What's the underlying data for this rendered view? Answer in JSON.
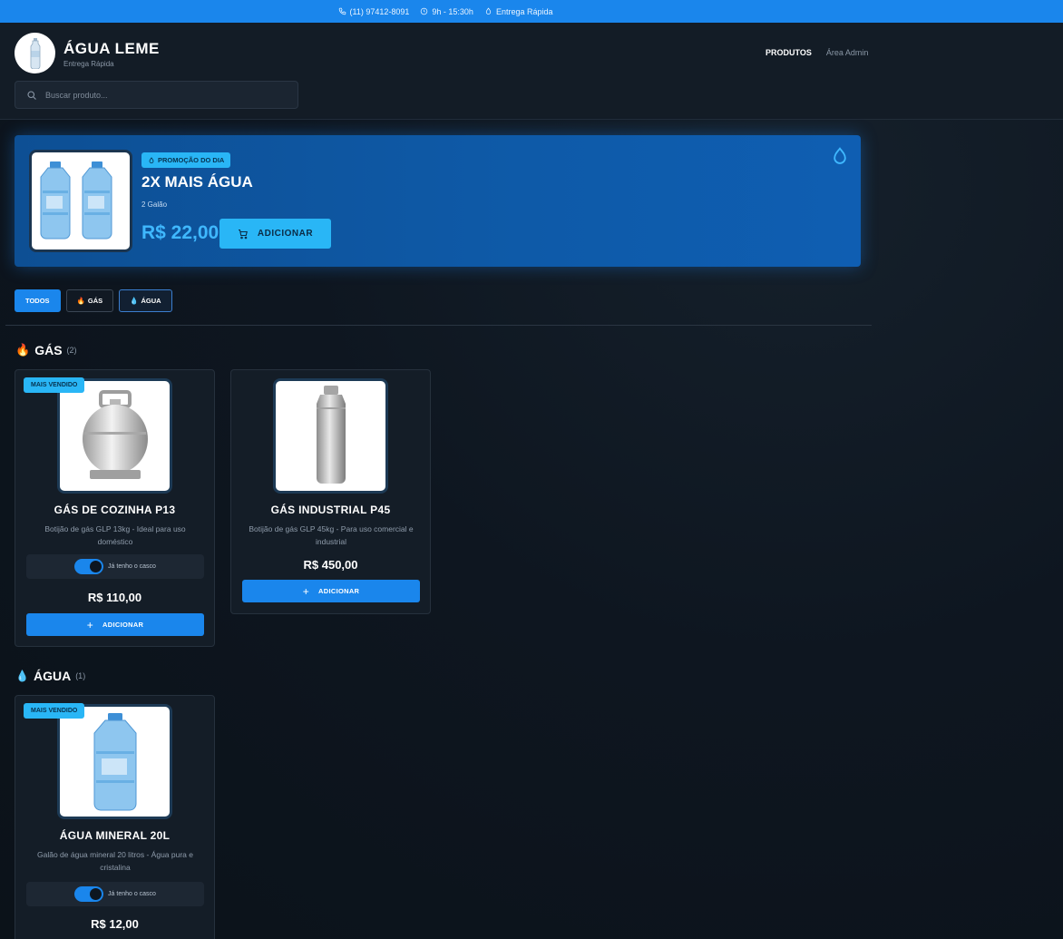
{
  "topbar": {
    "phone": "(11) 97412-8091",
    "hours": "9h - 15:30h",
    "delivery": "Entrega Rápida"
  },
  "header": {
    "brand_name": "ÁGUA LEME",
    "brand_tagline": "Entrega Rápida",
    "nav": [
      {
        "label": "PRODUTOS",
        "active": true
      },
      {
        "label": "Área Admin",
        "active": false
      }
    ],
    "search_placeholder": "Buscar produto..."
  },
  "promo": {
    "badge": "PROMOÇÃO DO DIA",
    "title": "2X MAIS ÁGUA",
    "subtitle": "2 Galão",
    "price": "R$ 22,00",
    "button_label": "ADICIONAR"
  },
  "filters": [
    {
      "label": "TODOS",
      "icon": "",
      "state": "active"
    },
    {
      "label": "GÁS",
      "icon": "🔥",
      "state": "default"
    },
    {
      "label": "ÁGUA",
      "icon": "💧",
      "state": "outlined"
    }
  ],
  "sections": {
    "gas": {
      "icon": "🔥",
      "title": "GÁS",
      "count": "(2)",
      "products": [
        {
          "badge": "MAIS VENDIDO",
          "name": "GÁS DE COZINHA P13",
          "description": "Botijão de gás GLP 13kg - Ideal para uso doméstico",
          "toggle_label": "Já tenho o casco",
          "price": "R$ 110,00",
          "button_label": "ADICIONAR"
        },
        {
          "badge": "",
          "name": "GÁS INDUSTRIAL P45",
          "description": "Botijão de gás GLP 45kg - Para uso comercial e industrial",
          "toggle_label": "",
          "price": "R$ 450,00",
          "button_label": "ADICIONAR"
        }
      ]
    },
    "agua": {
      "icon": "💧",
      "title": "ÁGUA",
      "count": "(1)",
      "products": [
        {
          "badge": "MAIS VENDIDO",
          "name": "ÁGUA MINERAL 20L",
          "description": "Galão de água mineral 20 litros - Água pura e cristalina",
          "toggle_label": "Já tenho o casco",
          "price": "R$ 12,00"
        }
      ]
    }
  },
  "colors": {
    "primary": "#1a86ec",
    "accent": "#29b6f6",
    "promo_bg": "#0e5aa8",
    "background": "#0e1620"
  }
}
